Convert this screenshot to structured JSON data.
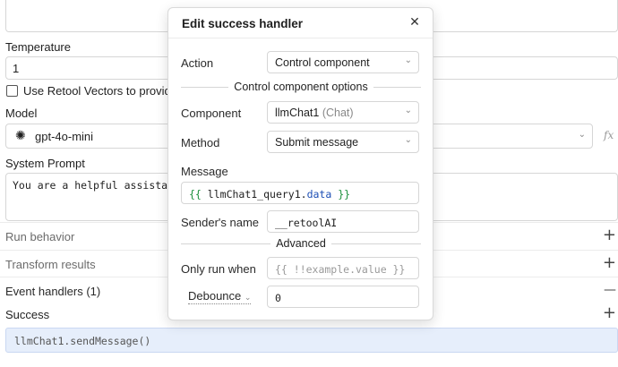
{
  "background": {
    "temperature_label": "Temperature",
    "temperature_value": "1",
    "vectors_label": "Use Retool Vectors to provide",
    "model_label": "Model",
    "model_value": "gpt-4o-mini",
    "fx_label": "fx",
    "system_prompt_label": "System Prompt",
    "system_prompt_value": "You are a helpful assistant",
    "sections": [
      {
        "label": "Run behavior",
        "sign": "+"
      },
      {
        "label": "Transform results",
        "sign": "+"
      },
      {
        "label": "Event handlers (1)",
        "sign": "—"
      }
    ],
    "success_label": "Success",
    "success_sign": "+",
    "success_code": "llmChat1.sendMessage()"
  },
  "modal": {
    "title": "Edit success handler",
    "action_label": "Action",
    "action_value": "Control component",
    "section_title": "Control component options",
    "component_label": "Component",
    "component_value": "llmChat1",
    "component_type": "(Chat)",
    "method_label": "Method",
    "method_value": "Submit message",
    "message_label": "Message",
    "message_open": "{{",
    "message_obj": "llmChat1_query1.",
    "message_prop": "data",
    "message_close": "}}",
    "sender_label": "Sender's name",
    "sender_value": "__retoolAI",
    "advanced_title": "Advanced",
    "only_run_label": "Only run when",
    "only_run_placeholder": "{{ !!example.value }}",
    "debounce_label": "Debounce",
    "debounce_value": "0"
  }
}
